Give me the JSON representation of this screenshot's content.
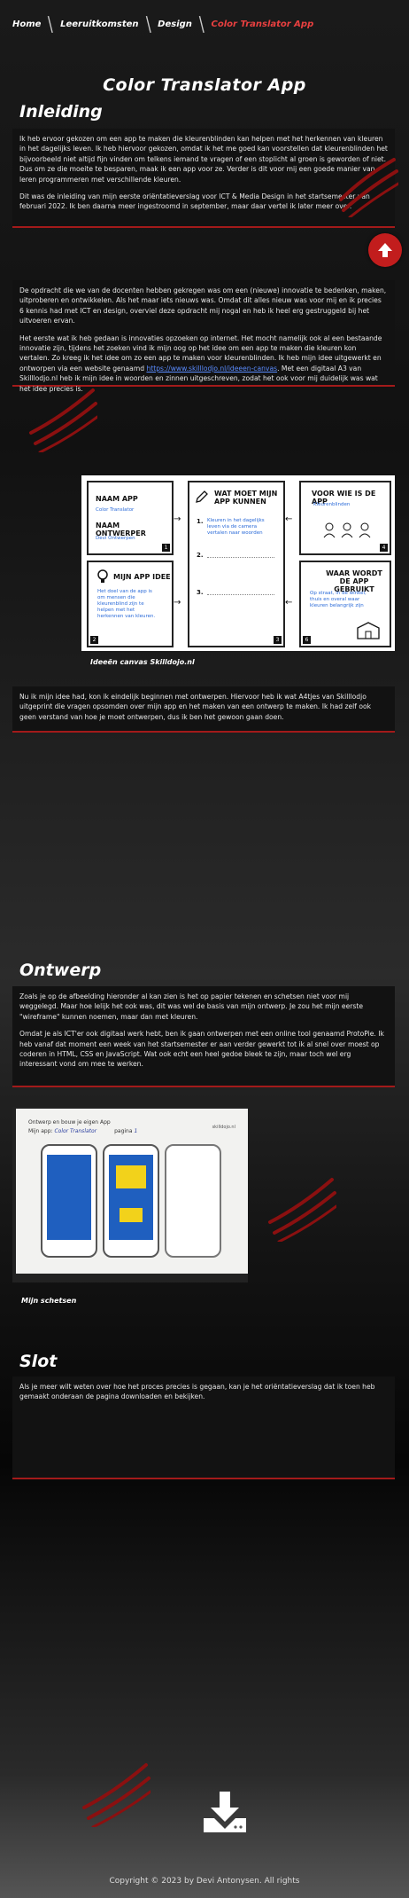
{
  "nav": {
    "items": [
      {
        "label": "Home"
      },
      {
        "label": "Leeruitkomsten"
      },
      {
        "label": "Design"
      },
      {
        "label": "Color Translator App"
      }
    ]
  },
  "page_title": "Color Translator App",
  "sections": {
    "intro": {
      "heading": "Inleiding",
      "paragraphs": [
        "Ik heb ervoor gekozen om een app te maken die kleurenblinden kan helpen met het herkennen van kleuren in het dagelijks leven. Ik heb hiervoor gekozen, omdat ik het me goed kan voorstellen dat kleurenblinden het bijvoorbeeld niet altijd fijn vinden om telkens iemand te vragen of een stoplicht al groen is geworden of niet. Dus om ze die moeite te besparen, maak ik een app voor ze. Verder is dit voor mij een goede manier van leren programmeren met verschillende kleuren.",
        "Dit was de inleiding van mijn eerste oriëntatieverslag voor ICT & Media Design in het startsemester van februari 2022. Ik ben daarna meer ingestroomd in september, maar daar vertel ik later meer over."
      ]
    },
    "process": {
      "paragraphs": [
        "De opdracht die we van de docenten hebben gekregen was om een (nieuwe) innovatie te bedenken, maken, uitproberen en ontwikkelen. Als het maar iets nieuws was. Omdat dit alles nieuw was voor mij en ik precies 6 kennis had met ICT en design, overviel deze opdracht mij nogal en heb ik heel erg gestruggeld bij het uitvoeren ervan.",
        "Het eerste wat ik heb gedaan is innovaties opzoeken op internet. Het mocht namelijk ook al een bestaande innovatie zijn, tijdens het zoeken vind ik mijn oog op het idee om een app te maken die kleuren kon vertalen. Zo kreeg ik het idee om zo een app te maken voor kleurenblinden. Ik heb mijn idee uitgewerkt en ontworpen via een website genaamd",
        ". Met een digitaal A3 van Skilllodjo.nl heb ik mijn idee in woorden en zinnen uitgeschreven, zodat het ook voor mij duidelijk was wat het idee precies is."
      ],
      "link_text": "https://www.skilllodjo.nl/ideeen-canvas"
    },
    "canvas_figure": {
      "caption": "Ideeën canvas Skilldojo.nl",
      "cards": {
        "c1_title1": "NAAM APP",
        "c1_val1": "Color Translator",
        "c1_title2": "NAAM ONTWERPER",
        "c1_val2": "Devi Ontwerpen",
        "c2_title": "MIJN APP IDEE",
        "c2_val": "Het doel van de app is om mensen die kleurenblind zijn te helpen met het herkennen van kleuren.",
        "c3_title": "WAT MOET MIJN APP KUNNEN",
        "c3_val": "Kleuren in het dagelijks leven via de camera vertalen naar woorden",
        "c4_title": "VOOR WIE IS DE APP",
        "c4_val": "Kleurenblinden",
        "c5_title": "WAAR WORDT DE APP GEBRUIKT",
        "c5_val": "Op straat, in de winkel, thuis en overal waar kleuren belangrijk zijn",
        "n1": "1",
        "n2": "2",
        "n3": "3",
        "n4": "4",
        "n5": "5",
        "n6": "6"
      }
    },
    "after_canvas": {
      "paragraphs": [
        "Nu ik mijn idee had, kon ik eindelijk beginnen met ontwerpen. Hiervoor heb ik wat A4tjes van Skilllodjo uitgeprint die vragen opsomden over mijn app en het maken van een ontwerp te maken. Ik had zelf ook geen verstand van hoe je moet ontwerpen, dus ik ben het gewoon gaan doen."
      ]
    },
    "design": {
      "heading": "Ontwerp",
      "paragraphs": [
        "Zoals je op de afbeelding hieronder al kan zien is het op papier tekenen en schetsen niet voor mij weggelegd. Maar hoe lelijk het ook was, dit was wel de basis van mijn ontwerp. Je zou het mijn eerste \"wireframe\" kunnen noemen, maar dan met kleuren.",
        "Omdat je als ICT'er ook digitaal werk hebt, ben ik gaan ontwerpen met een online tool genaamd ProtoPie. Ik heb vanaf dat moment een week van het startsemester er aan verder gewerkt tot ik al snel over moest op coderen in HTML, CSS en JavaScript. Wat ook echt een heel gedoe bleek te zijn, maar toch wel erg interessant vond om mee te werken."
      ]
    },
    "sketch_figure": {
      "caption": "Mijn schetsen",
      "sheet_title": "Ontwerp en bouw je eigen App",
      "sheet_app_label": "Mijn app:",
      "sheet_app_value": "Color Translator",
      "sheet_page_label": "pagina",
      "sheet_page_value": "1",
      "logo": "skilldojo.nl"
    },
    "conclusion": {
      "heading": "Slot",
      "paragraphs": [
        "Als je meer wilt weten over hoe het proces precies is gegaan, kan je het oriëntatieverslag dat ik toen heb gemaakt onderaan de pagina downloaden en bekijken."
      ]
    }
  },
  "footer": {
    "text": "Copyright © 2023 by Devi Antonysen. All rights"
  },
  "colors": {
    "accent": "#c21d1d",
    "border": "#a31a1a",
    "nav_active": "#e94040",
    "link": "#5a8cff"
  },
  "icons": {
    "scroll_up": "arrow-up-icon",
    "download": "download-icon"
  }
}
